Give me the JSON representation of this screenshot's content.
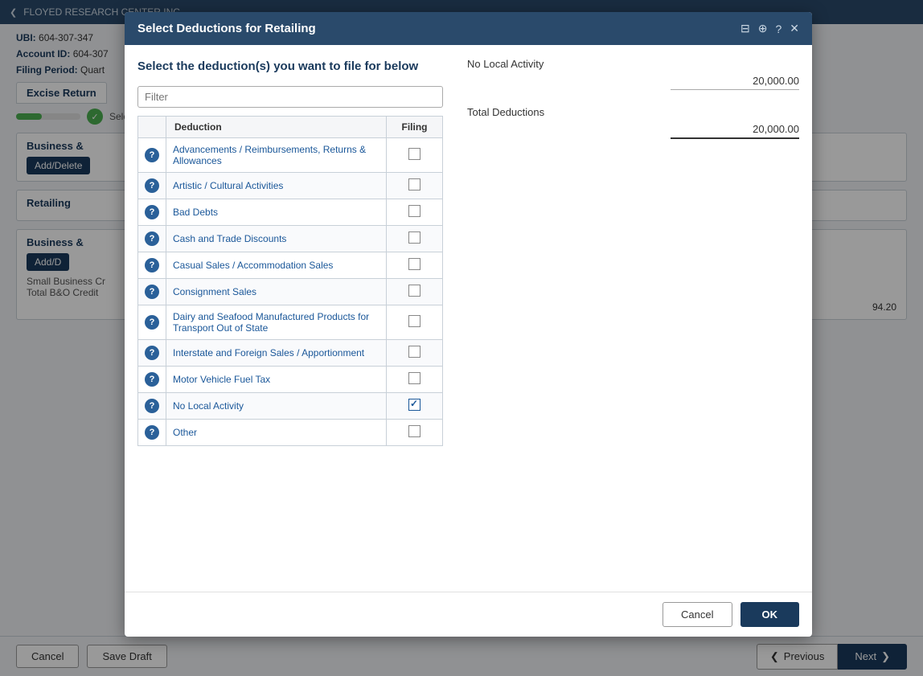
{
  "header": {
    "company": "FLOYED RESEARCH CENTER INC",
    "ubi_label": "UBI:",
    "ubi_value": "604-307-347",
    "account_label": "Account ID:",
    "account_value": "604-307",
    "filing_period_label": "Filing Period:",
    "filing_period_value": "Quart"
  },
  "excise_return": {
    "tab_label": "Excise Return",
    "select_ta_label": "Select Ta"
  },
  "background_sections": [
    {
      "title": "Business &",
      "btn_label": "Add/Delete"
    },
    {
      "title": "Retailing"
    },
    {
      "title": "Business &",
      "btn_label": "Add/D",
      "small_biz": "Small Business Cr",
      "total_bao": "Total B&O Credit",
      "value": "94.20"
    }
  ],
  "bottom_bar": {
    "cancel_label": "Cancel",
    "save_draft_label": "Save Draft",
    "previous_label": "Previous",
    "next_label": "Next"
  },
  "modal": {
    "title": "Select Deductions for Retailing",
    "instruction": "Select the deduction(s) you want to file for below",
    "filter_placeholder": "Filter",
    "columns": {
      "deduction": "Deduction",
      "filing": "Filing"
    },
    "deductions": [
      {
        "name": "Advancements / Reimbursements, Returns & Allowances",
        "checked": false
      },
      {
        "name": "Artistic / Cultural Activities",
        "checked": false
      },
      {
        "name": "Bad Debts",
        "checked": false
      },
      {
        "name": "Cash and Trade Discounts",
        "checked": false
      },
      {
        "name": "Casual Sales / Accommodation Sales",
        "checked": false
      },
      {
        "name": "Consignment Sales",
        "checked": false
      },
      {
        "name": "Dairy and Seafood Manufactured Products for Transport Out of State",
        "checked": false
      },
      {
        "name": "Interstate and Foreign Sales / Apportionment",
        "checked": false
      },
      {
        "name": "Motor Vehicle Fuel Tax",
        "checked": false
      },
      {
        "name": "No Local Activity",
        "checked": true
      },
      {
        "name": "Other",
        "checked": false
      }
    ],
    "right_panel": {
      "no_local_activity_label": "No Local Activity",
      "no_local_activity_value": "20,000.00",
      "total_deductions_label": "Total Deductions",
      "total_deductions_value": "20,000.00"
    },
    "footer": {
      "cancel_label": "Cancel",
      "ok_label": "OK"
    },
    "icons": {
      "copy": "⊟",
      "globe": "⊕",
      "help": "?",
      "close": "✕"
    }
  }
}
